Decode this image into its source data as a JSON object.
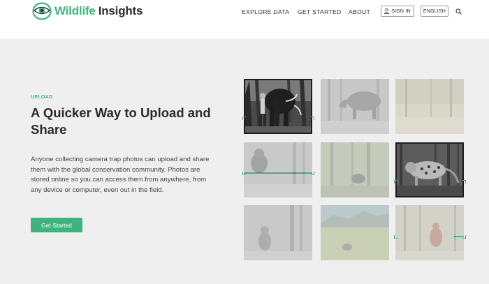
{
  "brand": {
    "word1": "Wildlife",
    "word2": "Insights",
    "accent": "#3cb57d",
    "icon": "eye-logo-icon"
  },
  "nav": {
    "explore": "EXPLORE DATA",
    "started": "GET STARTED",
    "about": "ABOUT",
    "signin": "SIGN IN",
    "language": "ENGLISH",
    "search_icon": "search-icon",
    "user_icon": "user-icon"
  },
  "hero": {
    "eyebrow": "UPLOAD",
    "headline": "A Quicker Way to Upload and Share",
    "body": "Anyone collecting camera trap photos can upload and share them with the global conservation community. Photos are stored online so you can access them from anywhere, from any device or computer, even out in the field.",
    "cta": "Get Started"
  },
  "grid": {
    "tiles": [
      {
        "subject": "man with elephant",
        "state": "active"
      },
      {
        "subject": "tapir",
        "state": "faded"
      },
      {
        "subject": "forest clearing",
        "state": "faded"
      },
      {
        "subject": "chimpanzee",
        "state": "faded"
      },
      {
        "subject": "duiker",
        "state": "faded"
      },
      {
        "subject": "jaguar",
        "state": "active"
      },
      {
        "subject": "monkey",
        "state": "faded"
      },
      {
        "subject": "bear in savanna",
        "state": "faded"
      },
      {
        "subject": "orangutan",
        "state": "faded"
      }
    ]
  }
}
